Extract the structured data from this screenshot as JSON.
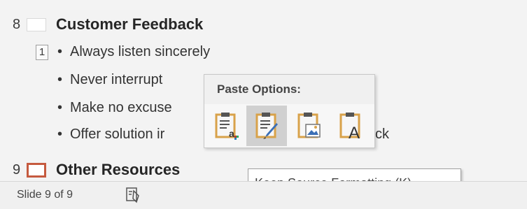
{
  "outline": {
    "slides": [
      {
        "number": "8",
        "title": "Customer Feedback",
        "bullets": [
          "Always listen sincerely",
          "Never interrupt",
          "Make no excuse",
          "Offer solution ir"
        ],
        "bullet_tail": "ck"
      },
      {
        "number": "9",
        "title": "Other Resources"
      }
    ],
    "comment_marker": "1",
    "bullet_symbol": "•"
  },
  "paste_popup": {
    "title": "Paste Options:",
    "options": [
      {
        "icon": "use-destination-theme-icon"
      },
      {
        "icon": "keep-source-formatting-icon"
      },
      {
        "icon": "paste-picture-icon"
      },
      {
        "icon": "keep-text-only-icon"
      }
    ]
  },
  "tooltip": {
    "text": "Keep Source Formatting (K)"
  },
  "status_bar": {
    "slide_counter": "Slide 9 of 9",
    "notes_icon": "notes-icon"
  },
  "colors": {
    "selected_slide_border": "#c55a3f",
    "clipboard_gold": "#d8a24a"
  }
}
